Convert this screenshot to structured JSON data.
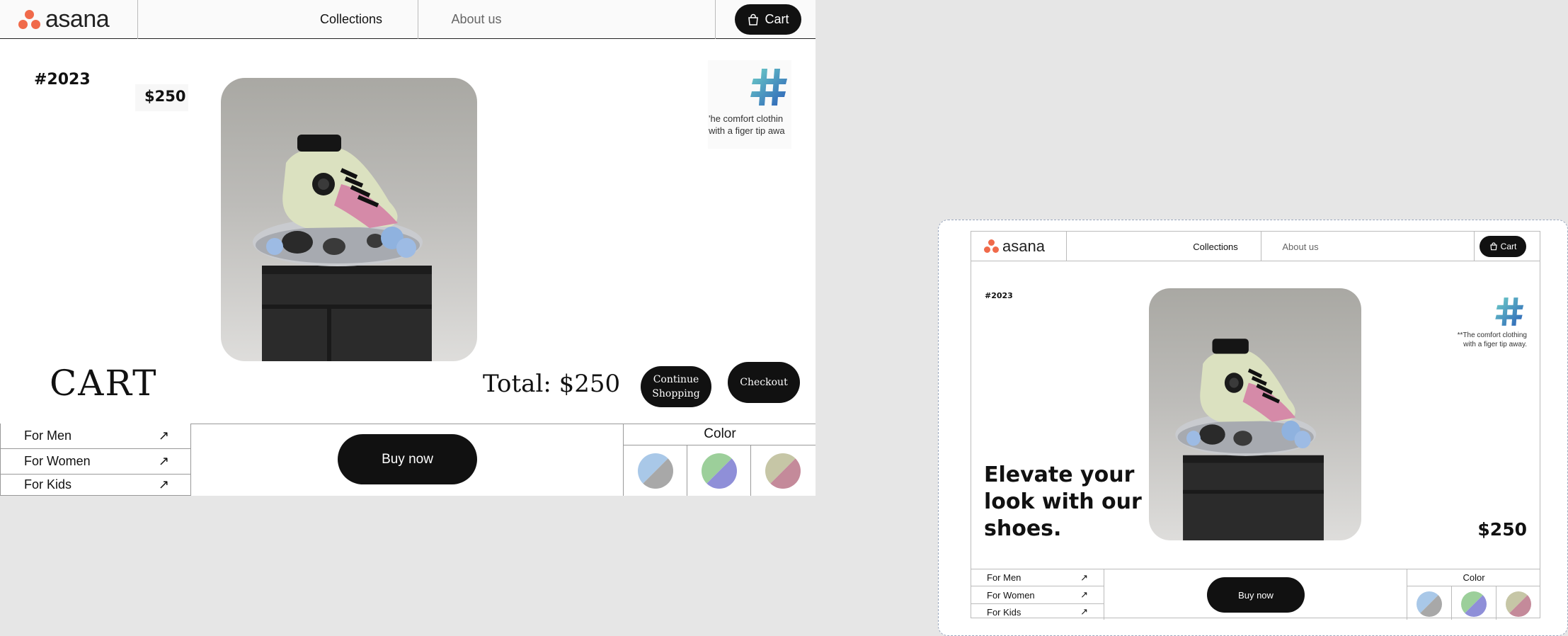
{
  "cart_page": {
    "brand": "asana",
    "nav": {
      "collections": "Collections",
      "about": "About us",
      "cart": "Cart"
    },
    "tag": "#2023",
    "price": "$250",
    "badge_text_line1": "'he comfort clothin",
    "badge_text_line2": "with  a figer tip awa",
    "cart_heading": "CART",
    "total": "Total: $250",
    "continue_line1": "Continue",
    "continue_line2": "Shopping",
    "checkout": "Checkout",
    "categories": [
      "For Men",
      "For Women",
      "For Kids"
    ],
    "buy_now": "Buy now",
    "color_label": "Color",
    "arrow_glyph": "↗"
  },
  "product_page": {
    "brand": "asana",
    "nav": {
      "collections": "Collections",
      "about": "About us",
      "cart": "Cart"
    },
    "tag": "#2023",
    "badge_text_line1": "**The comfort clothing",
    "badge_text_line2": "with  a figer tip away.",
    "headline_line1": "Elevate your",
    "headline_line2": "look with our",
    "headline_line3": "shoes.",
    "price": "$250",
    "categories": [
      "For Men",
      "For Women",
      "For Kids"
    ],
    "buy_now": "Buy now",
    "color_label": "Color",
    "arrow_glyph": "↗"
  },
  "colors": {
    "brand_orange": "#f06a4a",
    "button_black": "#111111",
    "swatches": [
      {
        "a": "#a9c8e8",
        "b": "#a8a8a8"
      },
      {
        "a": "#9ccf9a",
        "b": "#8f8fd8"
      },
      {
        "a": "#c6c6a6",
        "b": "#c48a9a"
      }
    ]
  },
  "icons": [
    "asana-logo-icon",
    "shopping-bag-icon",
    "arrow-up-right-icon",
    "hashtag-3d-icon",
    "sneaker-image"
  ]
}
